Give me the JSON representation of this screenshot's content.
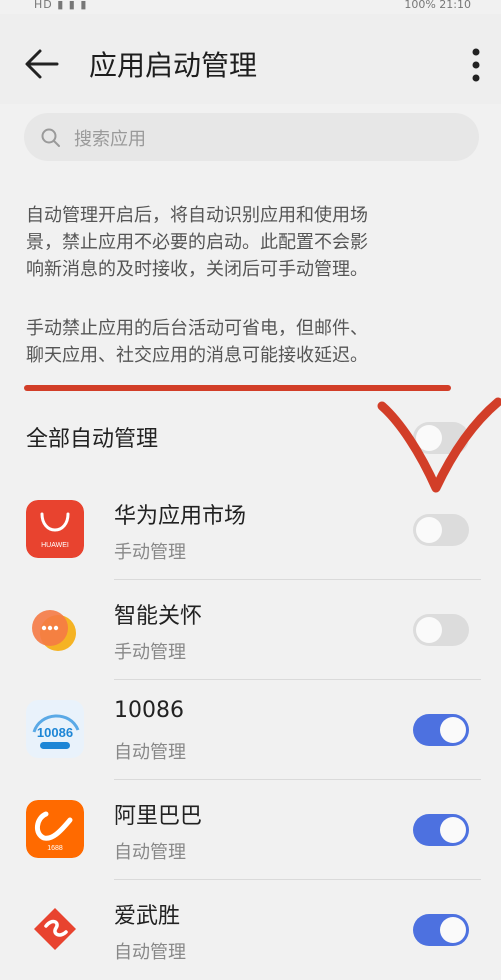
{
  "status": {
    "left": "HD ▮ ▮ ▮",
    "battery": "100%",
    "time": "21:10"
  },
  "header": {
    "title": "应用启动管理",
    "back_icon": "arrow-left-icon",
    "more_icon": "more-vert-icon"
  },
  "search": {
    "placeholder": "搜索应用",
    "icon": "search-icon"
  },
  "description": {
    "line1": "自动管理开启后，将自动识别应用和使用场",
    "line2": "景，禁止应用不必要的启动。此配置不会影",
    "line3": "响新消息的及时接收，关闭后可手动管理。",
    "line4": "手动禁止应用的后台活动可省电，但邮件、",
    "line5": "聊天应用、社交应用的消息可能接收延迟。"
  },
  "all_auto": {
    "label": "全部自动管理",
    "enabled": false
  },
  "apps": [
    {
      "name": "华为应用市场",
      "mode": "手动管理",
      "enabled": false,
      "icon": "huawei-appgallery-icon",
      "icon_text": "HUAWEI",
      "color": "#e8432f"
    },
    {
      "name": "智能关怀",
      "mode": "手动管理",
      "enabled": false,
      "icon": "smart-care-icon",
      "color": "#f29b3a"
    },
    {
      "name": "10086",
      "mode": "自动管理",
      "enabled": true,
      "icon": "china-mobile-10086-icon",
      "icon_text": "10086",
      "color": "#1e86d6"
    },
    {
      "name": "阿里巴巴",
      "mode": "自动管理",
      "enabled": true,
      "icon": "alibaba-icon",
      "icon_text": "1688",
      "color": "#ff6a00"
    },
    {
      "name": "爱武胜",
      "mode": "自动管理",
      "enabled": true,
      "icon": "aiwusheng-icon",
      "color": "#e8432f"
    }
  ],
  "colors": {
    "toggle_on": "#4d71e0",
    "toggle_off": "#dcdcdc",
    "annotation_red": "#d23e28"
  }
}
